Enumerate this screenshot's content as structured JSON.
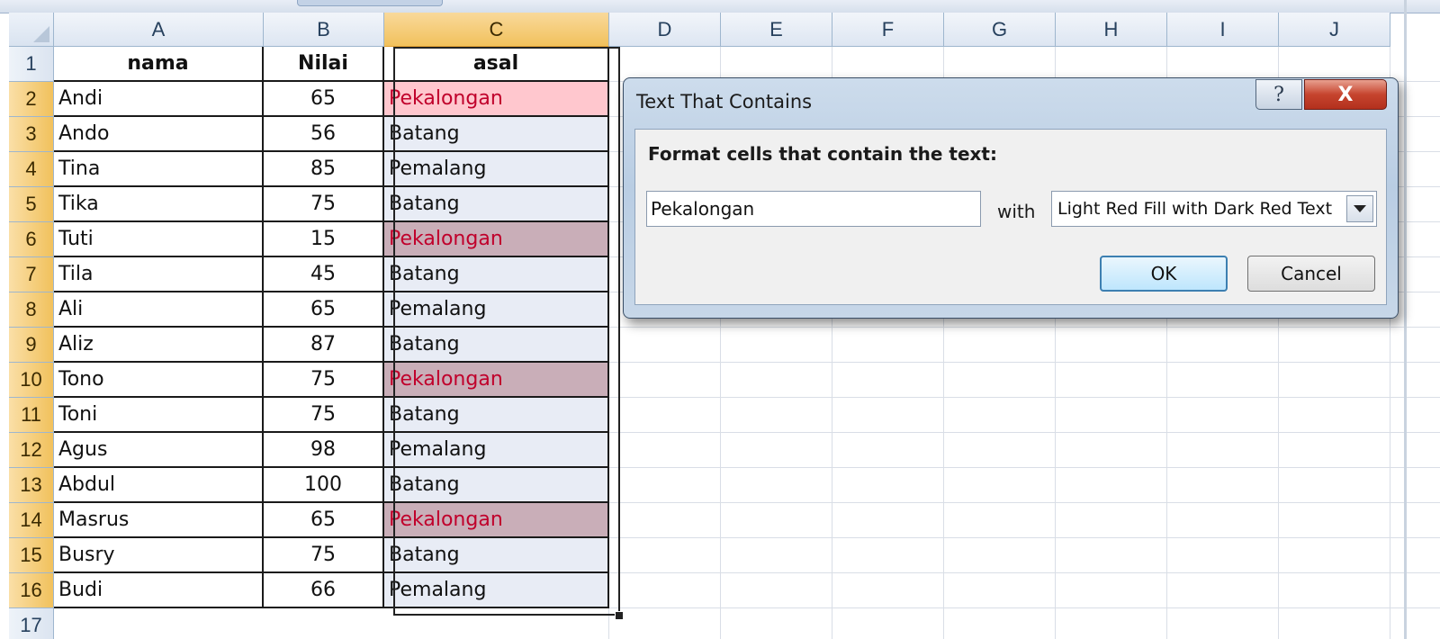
{
  "columns": [
    "A",
    "B",
    "C",
    "D",
    "E",
    "F",
    "G",
    "H",
    "I",
    "J"
  ],
  "header_row": {
    "nama": "nama",
    "nilai": "Nilai",
    "asal": "asal"
  },
  "rows": [
    {
      "n": "2",
      "nama": "Andi",
      "nilai": "65",
      "asal": "Pekalongan",
      "match": true
    },
    {
      "n": "3",
      "nama": "Ando",
      "nilai": "56",
      "asal": "Batang",
      "match": false
    },
    {
      "n": "4",
      "nama": "Tina",
      "nilai": "85",
      "asal": "Pemalang",
      "match": false
    },
    {
      "n": "5",
      "nama": "Tika",
      "nilai": "75",
      "asal": "Batang",
      "match": false
    },
    {
      "n": "6",
      "nama": "Tuti",
      "nilai": "15",
      "asal": "Pekalongan",
      "match": true
    },
    {
      "n": "7",
      "nama": "Tila",
      "nilai": "45",
      "asal": "Batang",
      "match": false
    },
    {
      "n": "8",
      "nama": "Ali",
      "nilai": "65",
      "asal": "Pemalang",
      "match": false
    },
    {
      "n": "9",
      "nama": "Aliz",
      "nilai": "87",
      "asal": "Batang",
      "match": false
    },
    {
      "n": "10",
      "nama": "Tono",
      "nilai": "75",
      "asal": "Pekalongan",
      "match": true
    },
    {
      "n": "11",
      "nama": "Toni",
      "nilai": "75",
      "asal": "Batang",
      "match": false
    },
    {
      "n": "12",
      "nama": "Agus",
      "nilai": "98",
      "asal": "Pemalang",
      "match": false
    },
    {
      "n": "13",
      "nama": "Abdul",
      "nilai": "100",
      "asal": "Batang",
      "match": false
    },
    {
      "n": "14",
      "nama": "Masrus",
      "nilai": "65",
      "asal": "Pekalongan",
      "match": true
    },
    {
      "n": "15",
      "nama": "Busry",
      "nilai": "75",
      "asal": "Batang",
      "match": false
    },
    {
      "n": "16",
      "nama": "Budi",
      "nilai": "66",
      "asal": "Pemalang",
      "match": false
    }
  ],
  "row_numbers": [
    "1",
    "2",
    "3",
    "4",
    "5",
    "6",
    "7",
    "8",
    "9",
    "10",
    "11",
    "12",
    "13",
    "14",
    "15",
    "16",
    "17"
  ],
  "selected_column": "C",
  "dialog": {
    "title": "Text That Contains",
    "help_icon": "?",
    "close_icon": "X",
    "label": "Format cells that contain the text:",
    "input_value": "Pekalongan",
    "with_label": "with",
    "format_value": "Light Red Fill with Dark Red Text",
    "ok_label": "OK",
    "cancel_label": "Cancel"
  },
  "colors": {
    "match_fill": "#ffc7ce",
    "match_text": "#c0002b",
    "selected_header": "#f1c15c"
  }
}
